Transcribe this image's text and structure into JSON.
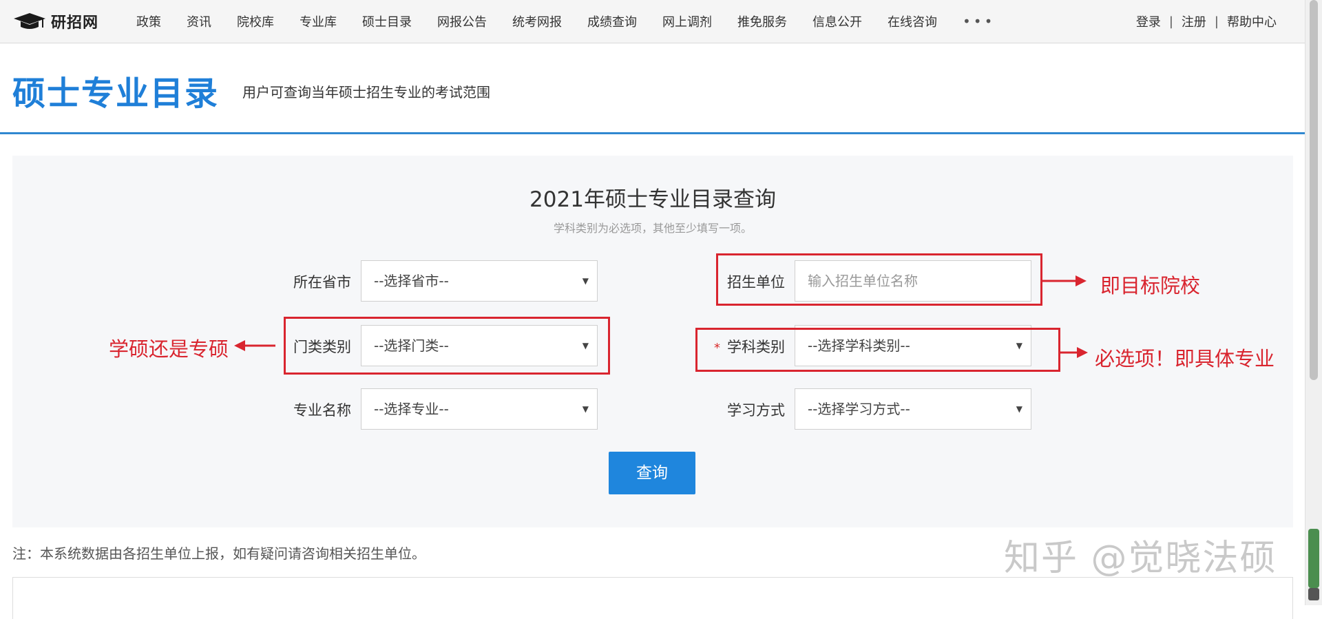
{
  "header": {
    "logo_text": "研招网",
    "nav": [
      "政策",
      "资讯",
      "院校库",
      "专业库",
      "硕士目录",
      "网报公告",
      "统考网报",
      "成绩查询",
      "网上调剂",
      "推免服务",
      "信息公开",
      "在线咨询"
    ],
    "more": "•••",
    "login": "登录",
    "register": "注册",
    "help": "帮助中心",
    "separator": "|"
  },
  "page": {
    "title": "硕士专业目录",
    "subtitle": "用户可查询当年硕士招生专业的考试范围"
  },
  "form": {
    "title": "2021年硕士专业目录查询",
    "hint": "学科类别为必选项，其他至少填写一项。",
    "province_label": "所在省市",
    "province_value": "--选择省市--",
    "unit_label": "招生单位",
    "unit_placeholder": "输入招生单位名称",
    "category_label": "门类类别",
    "category_value": "--选择门类--",
    "required_mark": "*",
    "discipline_label": "学科类别",
    "discipline_value": "--选择学科类别--",
    "major_label": "专业名称",
    "major_value": "--选择专业--",
    "mode_label": "学习方式",
    "mode_value": "--选择学习方式--",
    "arrow": "▼",
    "submit": "查询"
  },
  "annotations": {
    "unit": "即目标院校",
    "category": "学硕还是专硕",
    "discipline": "必选项！即具体专业",
    "color": "#d9252f"
  },
  "footer": {
    "note": "注：本系统数据由各招生单位上报，如有疑问请咨询相关招生单位。",
    "watermark": "知乎 @觉晓法硕"
  },
  "colors": {
    "accent": "#1f7fd8",
    "button": "#1f86dd"
  }
}
